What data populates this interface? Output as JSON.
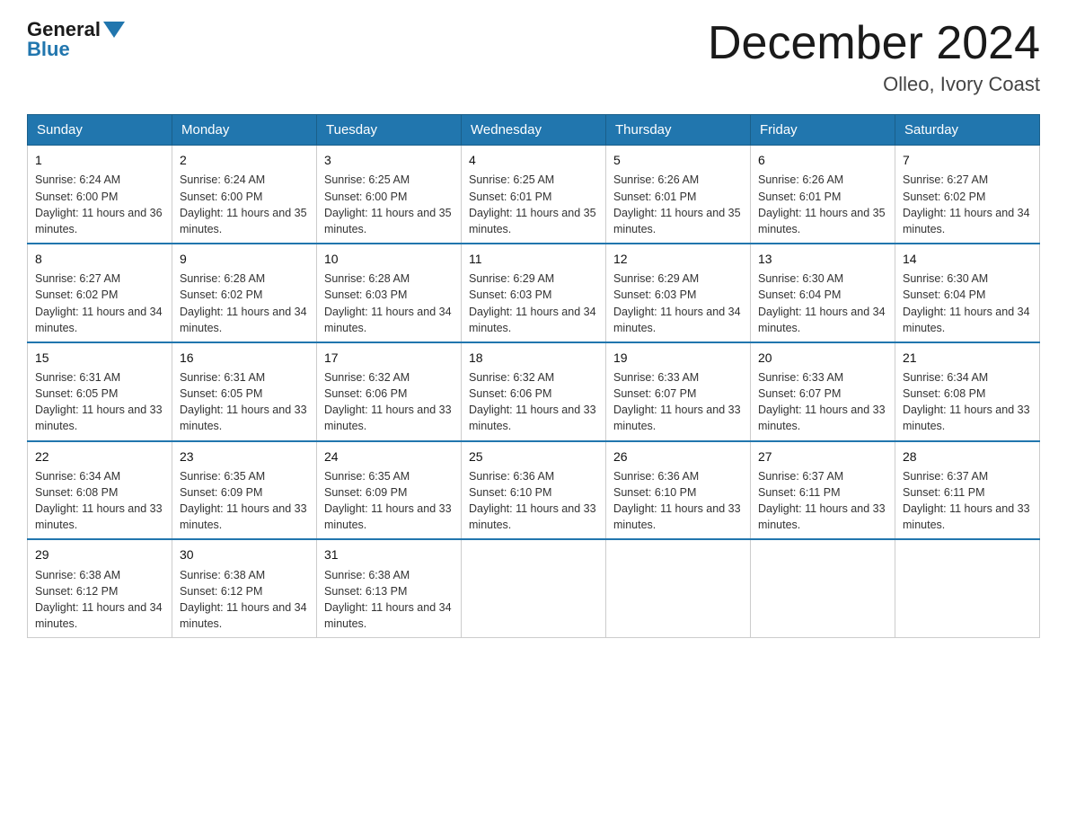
{
  "header": {
    "logo_general": "General",
    "logo_blue": "Blue",
    "title": "December 2024",
    "subtitle": "Olleo, Ivory Coast"
  },
  "days_of_week": [
    "Sunday",
    "Monday",
    "Tuesday",
    "Wednesday",
    "Thursday",
    "Friday",
    "Saturday"
  ],
  "weeks": [
    [
      {
        "day": 1,
        "sunrise": "6:24 AM",
        "sunset": "6:00 PM",
        "daylight": "11 hours and 36 minutes"
      },
      {
        "day": 2,
        "sunrise": "6:24 AM",
        "sunset": "6:00 PM",
        "daylight": "11 hours and 35 minutes"
      },
      {
        "day": 3,
        "sunrise": "6:25 AM",
        "sunset": "6:00 PM",
        "daylight": "11 hours and 35 minutes"
      },
      {
        "day": 4,
        "sunrise": "6:25 AM",
        "sunset": "6:01 PM",
        "daylight": "11 hours and 35 minutes"
      },
      {
        "day": 5,
        "sunrise": "6:26 AM",
        "sunset": "6:01 PM",
        "daylight": "11 hours and 35 minutes"
      },
      {
        "day": 6,
        "sunrise": "6:26 AM",
        "sunset": "6:01 PM",
        "daylight": "11 hours and 35 minutes"
      },
      {
        "day": 7,
        "sunrise": "6:27 AM",
        "sunset": "6:02 PM",
        "daylight": "11 hours and 34 minutes"
      }
    ],
    [
      {
        "day": 8,
        "sunrise": "6:27 AM",
        "sunset": "6:02 PM",
        "daylight": "11 hours and 34 minutes"
      },
      {
        "day": 9,
        "sunrise": "6:28 AM",
        "sunset": "6:02 PM",
        "daylight": "11 hours and 34 minutes"
      },
      {
        "day": 10,
        "sunrise": "6:28 AM",
        "sunset": "6:03 PM",
        "daylight": "11 hours and 34 minutes"
      },
      {
        "day": 11,
        "sunrise": "6:29 AM",
        "sunset": "6:03 PM",
        "daylight": "11 hours and 34 minutes"
      },
      {
        "day": 12,
        "sunrise": "6:29 AM",
        "sunset": "6:03 PM",
        "daylight": "11 hours and 34 minutes"
      },
      {
        "day": 13,
        "sunrise": "6:30 AM",
        "sunset": "6:04 PM",
        "daylight": "11 hours and 34 minutes"
      },
      {
        "day": 14,
        "sunrise": "6:30 AM",
        "sunset": "6:04 PM",
        "daylight": "11 hours and 34 minutes"
      }
    ],
    [
      {
        "day": 15,
        "sunrise": "6:31 AM",
        "sunset": "6:05 PM",
        "daylight": "11 hours and 33 minutes"
      },
      {
        "day": 16,
        "sunrise": "6:31 AM",
        "sunset": "6:05 PM",
        "daylight": "11 hours and 33 minutes"
      },
      {
        "day": 17,
        "sunrise": "6:32 AM",
        "sunset": "6:06 PM",
        "daylight": "11 hours and 33 minutes"
      },
      {
        "day": 18,
        "sunrise": "6:32 AM",
        "sunset": "6:06 PM",
        "daylight": "11 hours and 33 minutes"
      },
      {
        "day": 19,
        "sunrise": "6:33 AM",
        "sunset": "6:07 PM",
        "daylight": "11 hours and 33 minutes"
      },
      {
        "day": 20,
        "sunrise": "6:33 AM",
        "sunset": "6:07 PM",
        "daylight": "11 hours and 33 minutes"
      },
      {
        "day": 21,
        "sunrise": "6:34 AM",
        "sunset": "6:08 PM",
        "daylight": "11 hours and 33 minutes"
      }
    ],
    [
      {
        "day": 22,
        "sunrise": "6:34 AM",
        "sunset": "6:08 PM",
        "daylight": "11 hours and 33 minutes"
      },
      {
        "day": 23,
        "sunrise": "6:35 AM",
        "sunset": "6:09 PM",
        "daylight": "11 hours and 33 minutes"
      },
      {
        "day": 24,
        "sunrise": "6:35 AM",
        "sunset": "6:09 PM",
        "daylight": "11 hours and 33 minutes"
      },
      {
        "day": 25,
        "sunrise": "6:36 AM",
        "sunset": "6:10 PM",
        "daylight": "11 hours and 33 minutes"
      },
      {
        "day": 26,
        "sunrise": "6:36 AM",
        "sunset": "6:10 PM",
        "daylight": "11 hours and 33 minutes"
      },
      {
        "day": 27,
        "sunrise": "6:37 AM",
        "sunset": "6:11 PM",
        "daylight": "11 hours and 33 minutes"
      },
      {
        "day": 28,
        "sunrise": "6:37 AM",
        "sunset": "6:11 PM",
        "daylight": "11 hours and 33 minutes"
      }
    ],
    [
      {
        "day": 29,
        "sunrise": "6:38 AM",
        "sunset": "6:12 PM",
        "daylight": "11 hours and 34 minutes"
      },
      {
        "day": 30,
        "sunrise": "6:38 AM",
        "sunset": "6:12 PM",
        "daylight": "11 hours and 34 minutes"
      },
      {
        "day": 31,
        "sunrise": "6:38 AM",
        "sunset": "6:13 PM",
        "daylight": "11 hours and 34 minutes"
      },
      null,
      null,
      null,
      null
    ]
  ]
}
